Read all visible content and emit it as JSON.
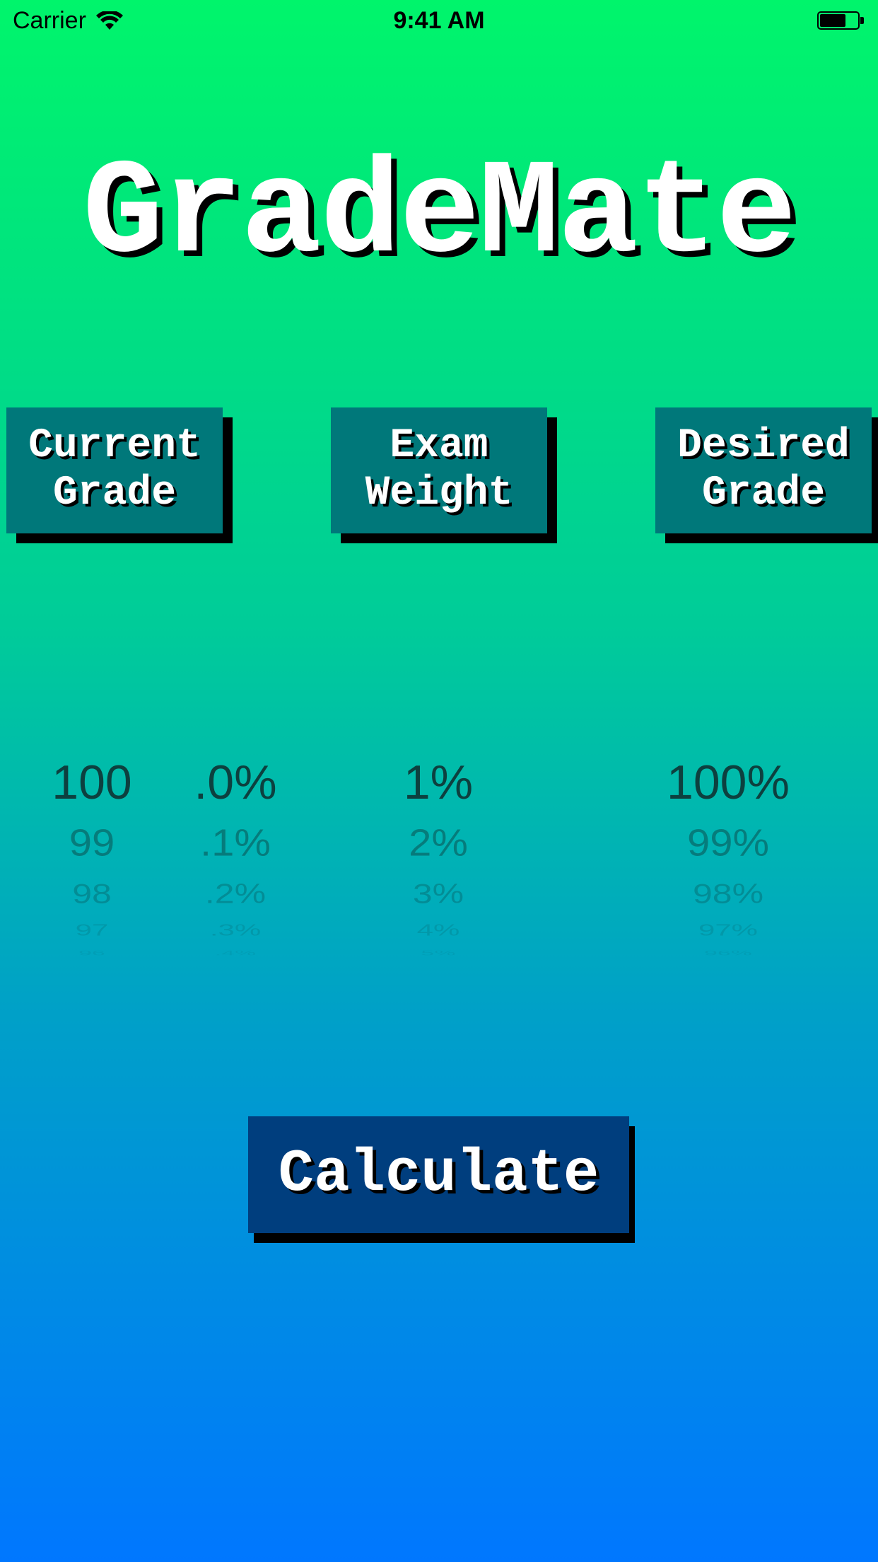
{
  "status_bar": {
    "carrier": "Carrier",
    "time": "9:41 AM",
    "icons": [
      "wifi-icon",
      "battery-icon"
    ]
  },
  "app": {
    "title": "GradeMate"
  },
  "labels": {
    "current_grade": "Current\nGrade",
    "exam_weight": "Exam\nWeight",
    "desired_grade": "Desired\nGrade"
  },
  "pickers": {
    "current_grade_integer": [
      "100",
      "99",
      "98",
      "97",
      "96"
    ],
    "current_grade_decimal": [
      ".0%",
      ".1%",
      ".2%",
      ".3%",
      ".4%"
    ],
    "exam_weight": [
      "1%",
      "2%",
      "3%",
      "4%",
      "5%"
    ],
    "desired_grade": [
      "100%",
      "99%",
      "98%",
      "97%",
      "96%"
    ]
  },
  "actions": {
    "calculate_label": "Calculate"
  },
  "colors": {
    "gradient_top": "#00f56b",
    "gradient_bottom": "#0077ff",
    "label_box": "#00787a",
    "calculate_button": "#003e7e"
  }
}
